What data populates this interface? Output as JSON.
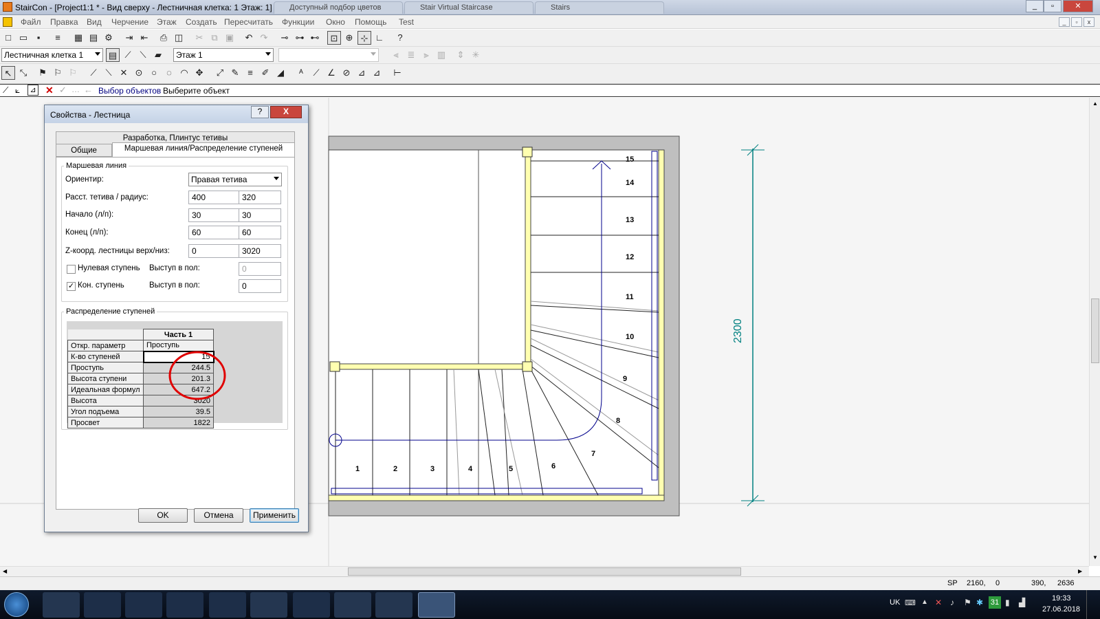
{
  "window": {
    "title": "StairCon - [Project1:1 * - Вид сверху - Лестничная клетка: 1 Этаж: 1]",
    "min": "0",
    "max": "1",
    "close": "r",
    "bg_tabs": [
      "Доступный подбор цветов",
      "Stair Virtual Staircase",
      "Stairs"
    ]
  },
  "menu": [
    "Файл",
    "Правка",
    "Вид",
    "Черчение",
    "Этаж",
    "Создать",
    "Пересчитать",
    "Функции",
    "Окно",
    "Помощь",
    "Test"
  ],
  "toolbar2": {
    "stair_combo": "Лестничная клетка 1",
    "floor_combo": "Этаж 1",
    "empty_combo": ""
  },
  "command_bar": {
    "mode": "Выбор объектов",
    "prompt": "Выберите объект"
  },
  "dialog": {
    "title": "Свойства - Лестница",
    "help": "?",
    "close": "X",
    "tab_top": "Разработка, Плинтус тетивы",
    "tab_general": "Общие",
    "tab_active": "Маршевая линия/Распределение ступеней",
    "group1": "Маршевая линия",
    "orient_label": "Ориентир:",
    "orient_value": "Правая тетива",
    "dist_label": "Расст. тетива / радиус:",
    "dist_a": "400",
    "dist_b": "320",
    "start_label": "Начало (л/п):",
    "start_a": "30",
    "start_b": "30",
    "end_label": "Конец (л/п):",
    "end_a": "60",
    "end_b": "60",
    "z_label": "Z-коорд. лестницы верх/низ:",
    "z_a": "0",
    "z_b": "3020",
    "zero_step": "Нулевая ступень",
    "zero_step_checked": false,
    "proj_label1": "Выступ в пол:",
    "proj_val1": "0",
    "end_step": "Кон. ступень",
    "end_step_checked": true,
    "check_mark": "✓",
    "proj_label2": "Выступ в пол:",
    "proj_val2": "0",
    "group2": "Распределение ступеней",
    "grid_header": "Часть 1",
    "grid_rows": [
      {
        "name": "Откр. параметр",
        "value": "Проступь"
      },
      {
        "name": "К-во ступеней",
        "value": "15"
      },
      {
        "name": "Проступь",
        "value": "244.5"
      },
      {
        "name": "Высота ступени",
        "value": "201.3"
      },
      {
        "name": "Идеальная формул",
        "value": "647.2"
      },
      {
        "name": "Высота",
        "value": "3020"
      },
      {
        "name": "Угол подъема",
        "value": "39.5"
      },
      {
        "name": "Просвет",
        "value": "1822"
      }
    ],
    "ok": "OK",
    "cancel": "Отмена",
    "apply": "Применить"
  },
  "drawing": {
    "dimension": "2300",
    "step_numbers": [
      "1",
      "2",
      "3",
      "4",
      "5",
      "6",
      "7",
      "8",
      "9",
      "10",
      "11",
      "12",
      "13",
      "14",
      "15"
    ],
    "highlight_color": "#e00000",
    "dim_color": "#008080"
  },
  "statusbar": {
    "sp": "SP",
    "c1": "2160,",
    "c2": "0",
    "c3": "390,",
    "c4": "2636"
  },
  "taskbar": {
    "lang": "UK",
    "time": "19:33",
    "date": "27.06.2018",
    "cal": "31"
  }
}
